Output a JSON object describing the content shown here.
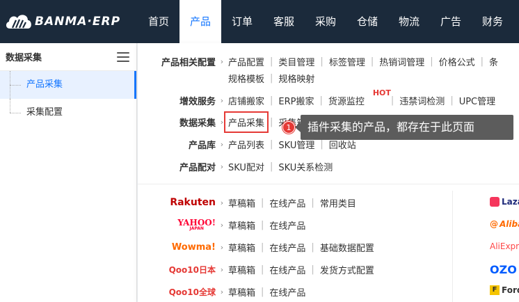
{
  "brand": {
    "name": "BANMA·ERP"
  },
  "nav": [
    {
      "label": "首页",
      "active": false
    },
    {
      "label": "产品",
      "active": true
    },
    {
      "label": "订单",
      "active": false
    },
    {
      "label": "客服",
      "active": false
    },
    {
      "label": "采购",
      "active": false
    },
    {
      "label": "仓储",
      "active": false
    },
    {
      "label": "物流",
      "active": false
    },
    {
      "label": "广告",
      "active": false
    },
    {
      "label": "财务",
      "active": false
    }
  ],
  "sidebar": {
    "title": "数据采集",
    "items": [
      {
        "label": "产品采集",
        "active": true
      },
      {
        "label": "采集配置",
        "active": false
      }
    ]
  },
  "config": [
    {
      "label": "产品相关配置",
      "links": [
        "产品配置",
        "类目管理",
        "标签管理",
        "热销词管理",
        "价格公式",
        "条"
      ]
    },
    {
      "label": "",
      "links": [
        "规格模板",
        "规格映射"
      ]
    },
    {
      "label": "增效服务",
      "links": [
        "店铺搬家",
        "ERP搬家",
        "货源监控",
        "违禁词检测",
        "UPC管理"
      ],
      "hot_badge": "HOT"
    },
    {
      "label": "数据采集",
      "links": [
        "产品采集",
        "采集箱"
      ]
    },
    {
      "label": "产品库",
      "links": [
        "产品列表",
        "SKU管理",
        "回收站"
      ]
    },
    {
      "label": "产品配对",
      "links": [
        "SKU配对",
        "SKU关系检测"
      ]
    }
  ],
  "platforms": [
    {
      "logo": "Rakuten",
      "color": "#bf0000",
      "links": [
        "草稿箱",
        "在线产品",
        "常用类目"
      ]
    },
    {
      "logo": "YAHOO!",
      "sub": "JAPAN",
      "color": "#ff0033",
      "links": [
        "草稿箱",
        "在线产品"
      ]
    },
    {
      "logo": "Wowma!",
      "color": "#ff6a00",
      "links": [
        "草稿箱",
        "在线产品",
        "基础数据配置"
      ]
    },
    {
      "logo": "Qoo10日本",
      "color": "#e53935",
      "links": [
        "草稿箱",
        "在线产品",
        "发货方式配置"
      ]
    },
    {
      "logo": "Qoo10全球",
      "color": "#e53935",
      "links": [
        "草稿箱",
        "在线产品"
      ]
    }
  ],
  "right_platforms": [
    {
      "logo": "Laza",
      "color": "#1e2a7a",
      "icon_color": "#f5365c"
    },
    {
      "logo": "Aliba",
      "color": "#ff6a00",
      "icon_color": "#ff6a00"
    },
    {
      "logo": "AliExpre",
      "color": "#ff4747",
      "icon_color": ""
    },
    {
      "logo": "OZO",
      "color": "#005bff",
      "icon_color": ""
    },
    {
      "logo": "Ford",
      "color": "#333333",
      "icon_color": "#f5c400"
    }
  ],
  "step_badge": "1",
  "tooltip": "插件采集的产品，都存在于此页面"
}
